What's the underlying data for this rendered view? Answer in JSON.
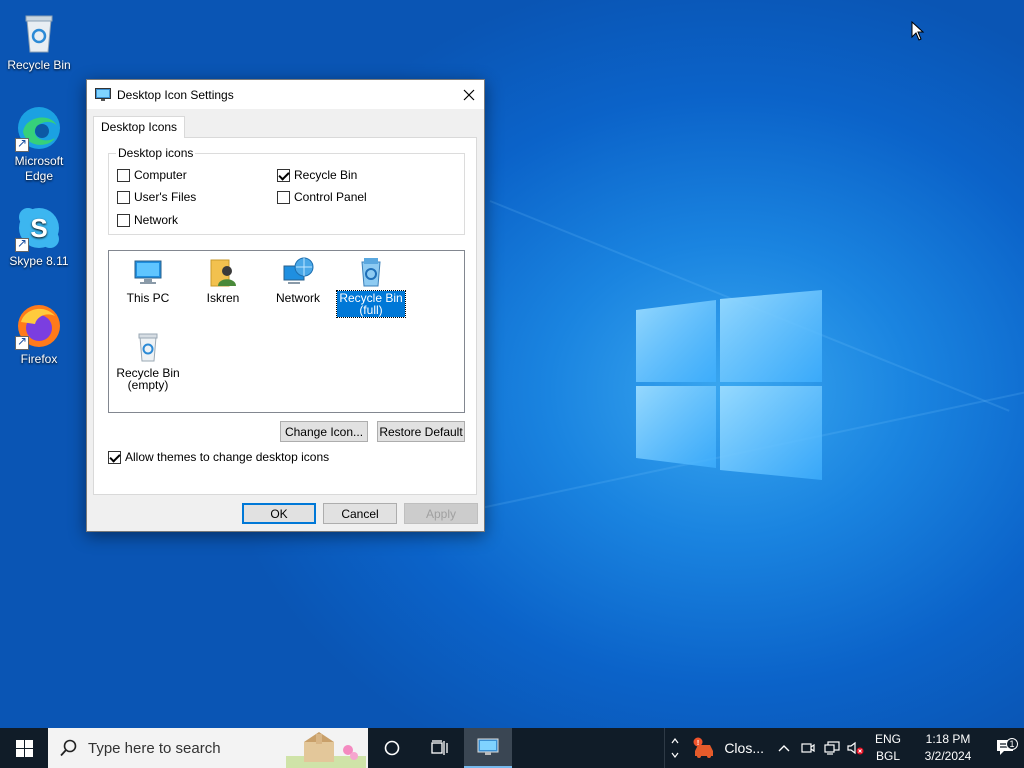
{
  "desktop": {
    "icons": [
      {
        "label": "Recycle Bin",
        "icon": "recycle-bin-icon"
      },
      {
        "label": "Microsoft Edge",
        "icon": "edge-icon"
      },
      {
        "label": "Skype 8.11",
        "icon": "skype-icon"
      },
      {
        "label": "Firefox",
        "icon": "firefox-icon"
      }
    ]
  },
  "dialog": {
    "title": "Desktop Icon Settings",
    "tab": "Desktop Icons",
    "group_label": "Desktop icons",
    "checkboxes": [
      {
        "label": "Computer",
        "checked": false
      },
      {
        "label": "Recycle Bin",
        "checked": true
      },
      {
        "label": "User's Files",
        "checked": false
      },
      {
        "label": "Control Panel",
        "checked": false
      },
      {
        "label": "Network",
        "checked": false
      }
    ],
    "icon_list": [
      {
        "label": "This PC",
        "icon": "this-pc-icon",
        "selected": false
      },
      {
        "label": "Iskren",
        "icon": "user-folder-icon",
        "selected": false
      },
      {
        "label": "Network",
        "icon": "network-icon",
        "selected": false
      },
      {
        "label": "Recycle Bin (full)",
        "line1": "Recycle Bin",
        "line2": "(full)",
        "icon": "recycle-bin-full-icon",
        "selected": true
      },
      {
        "label": "Recycle Bin (empty)",
        "line1": "Recycle Bin",
        "line2": "(empty)",
        "icon": "recycle-bin-empty-icon",
        "selected": false
      }
    ],
    "change_icon_label": "Change Icon...",
    "restore_default_label": "Restore Default",
    "allow_themes_label": "Allow themes to change desktop icons",
    "allow_themes_checked": true,
    "ok_label": "OK",
    "cancel_label": "Cancel",
    "apply_label": "Apply"
  },
  "taskbar": {
    "search_placeholder": "Type here to search",
    "weather_text": "Clos...",
    "lang_top": "ENG",
    "lang_bottom": "BGL",
    "time": "1:18 PM",
    "date": "3/2/2024",
    "notification_count": "1"
  },
  "colors": {
    "accent": "#0078d7",
    "taskbar": "#101c28",
    "desktop": "#0b63c9"
  }
}
